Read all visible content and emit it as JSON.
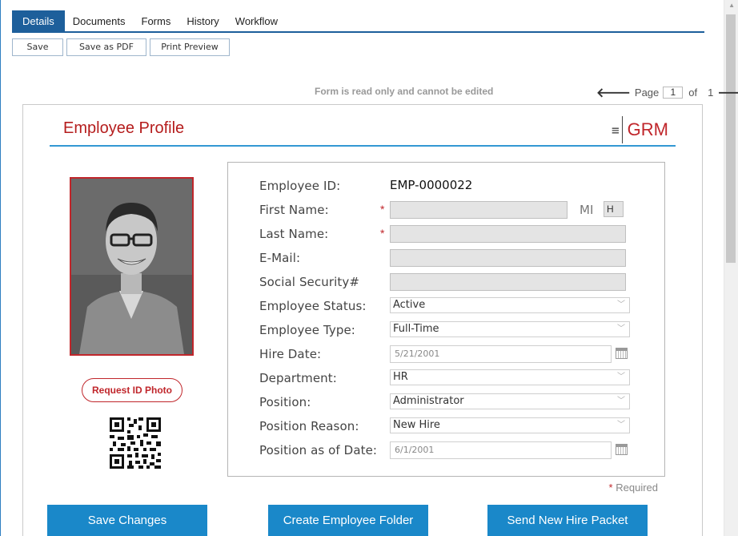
{
  "tabs": [
    {
      "label": "Details",
      "active": true
    },
    {
      "label": "Documents",
      "active": false
    },
    {
      "label": "Forms",
      "active": false
    },
    {
      "label": "History",
      "active": false
    },
    {
      "label": "Workflow",
      "active": false
    }
  ],
  "toolbar": {
    "save": "Save",
    "save_pdf": "Save as PDF",
    "print_preview": "Print Preview"
  },
  "readonly_message": "Form is read only and cannot be edited",
  "pager": {
    "page_label": "Page",
    "current": "1",
    "of_label": "of",
    "total": "1"
  },
  "form": {
    "title": "Employee Profile",
    "logo_text": "GRM",
    "request_photo": "Request ID Photo",
    "required_star": "*",
    "required_note": "Required",
    "fields": {
      "employee_id": {
        "label": "Employee ID:",
        "value": "EMP-0000022"
      },
      "first_name": {
        "label": "First Name:",
        "value": ""
      },
      "mi": {
        "label": "MI",
        "value": "H"
      },
      "last_name": {
        "label": "Last Name:",
        "value": ""
      },
      "email": {
        "label": "E-Mail:",
        "value": ""
      },
      "ssn": {
        "label": "Social Security#",
        "value": ""
      },
      "status": {
        "label": "Employee Status:",
        "value": "Active"
      },
      "type": {
        "label": "Employee Type:",
        "value": "Full-Time"
      },
      "hire_date": {
        "label": "Hire Date:",
        "value": "5/21/2001"
      },
      "department": {
        "label": "Department:",
        "value": "HR"
      },
      "position": {
        "label": "Position:",
        "value": "Administrator"
      },
      "position_reason": {
        "label": "Position Reason:",
        "value": "New Hire"
      },
      "position_date": {
        "label": "Position as of Date:",
        "value": "6/1/2001"
      }
    }
  },
  "actions": {
    "save": "Save Changes",
    "folder": "Create Employee Folder",
    "packet": "Send New Hire Packet"
  },
  "colors": {
    "accent": "#1d5f9b",
    "brand_red": "#c0262b",
    "button_blue": "#1a88c9"
  }
}
